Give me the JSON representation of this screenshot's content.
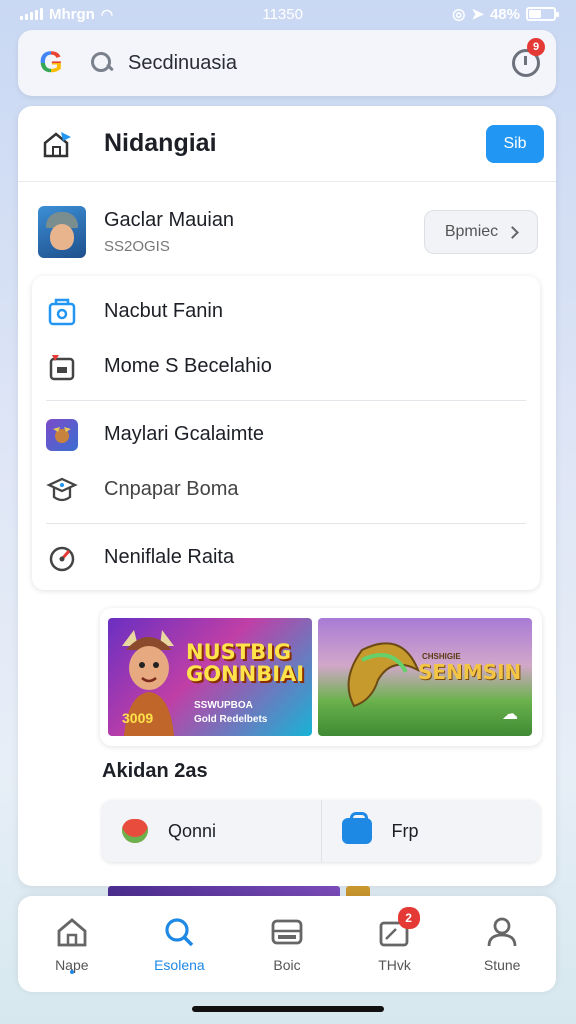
{
  "status_bar": {
    "carrier": "Mhrgn",
    "time": "11350",
    "battery": "48%",
    "battery_level": 0.48
  },
  "search": {
    "query": "Secdinuasia",
    "badge": "9"
  },
  "header": {
    "title": "Nidangiai",
    "button": "Sib"
  },
  "app": {
    "name": "Gaclar Mauian",
    "sub": "SS2OGIS",
    "button": "Bpmiec"
  },
  "menu": [
    {
      "label": "Nacbut Fanin",
      "icon": "shield-folder-icon"
    },
    {
      "label": "Mome S Becelahio",
      "icon": "calendar-icon"
    },
    {
      "label": "Maylari Gcalaimte",
      "icon": "game-character-icon"
    },
    {
      "label": "Cnpapar Boma",
      "icon": "graduation-cap-icon"
    },
    {
      "label": "Neniflale Raita",
      "icon": "gauge-icon"
    }
  ],
  "banners": {
    "left": {
      "title_line1": "NUSTBIG",
      "title_line2": "GONNBIAI",
      "price": "3009",
      "tag_line1": "SSWUPBOA",
      "tag_line2": "Gold Redelbets"
    },
    "right": {
      "title": "SENMSIN",
      "subtitle": "CHSHIGIE"
    }
  },
  "section": {
    "title": "Akidan 2as"
  },
  "actions": [
    {
      "label": "Qonni",
      "icon": "apple-icon"
    },
    {
      "label": "Frp",
      "icon": "shopping-bag-icon"
    }
  ],
  "nav": [
    {
      "label": "Nape",
      "icon": "home-icon",
      "active": false,
      "badge": ""
    },
    {
      "label": "Esolena",
      "icon": "search-icon",
      "active": true,
      "badge": ""
    },
    {
      "label": "Boic",
      "icon": "library-icon",
      "active": false,
      "badge": ""
    },
    {
      "label": "THvk",
      "icon": "inbox-icon",
      "active": false,
      "badge": "2"
    },
    {
      "label": "Stune",
      "icon": "profile-icon",
      "active": false,
      "badge": ""
    }
  ],
  "colors": {
    "accent": "#2196f3",
    "badge": "#e53935"
  }
}
